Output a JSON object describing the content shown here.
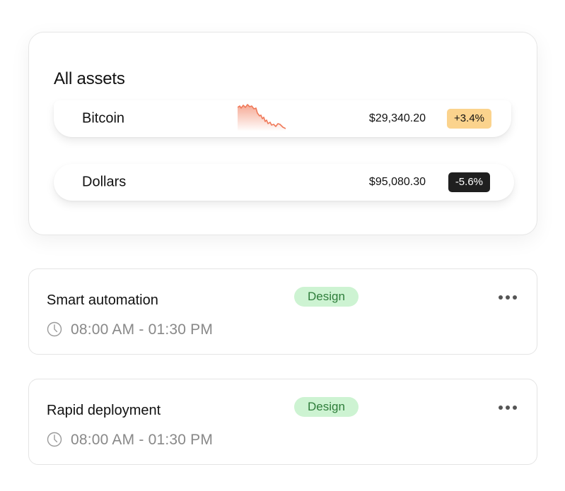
{
  "assets": {
    "title": "All assets",
    "rows": [
      {
        "name": "Bitcoin",
        "price": "$29,340.20",
        "change": "+3.4%",
        "trend": "up",
        "has_sparkline": true
      },
      {
        "name": "Dollars",
        "price": "$95,080.30",
        "change": "-5.6%",
        "trend": "down",
        "has_sparkline": false
      }
    ]
  },
  "tasks": [
    {
      "title": "Smart automation",
      "tag": "Design",
      "time": "08:00 AM - 01:30 PM",
      "menu_icon": "more-dots-icon",
      "time_icon": "clock-icon"
    },
    {
      "title": "Rapid deployment",
      "tag": "Design",
      "time": "08:00 AM - 01:30 PM",
      "menu_icon": "more-dots-icon",
      "time_icon": "clock-icon"
    }
  ],
  "colors": {
    "up_badge": "#fbd38d",
    "down_badge": "#1f1f1f",
    "tag_bg": "#cdf3d2",
    "tag_text": "#2e7d3a",
    "sparkline": "#f07a5a"
  }
}
